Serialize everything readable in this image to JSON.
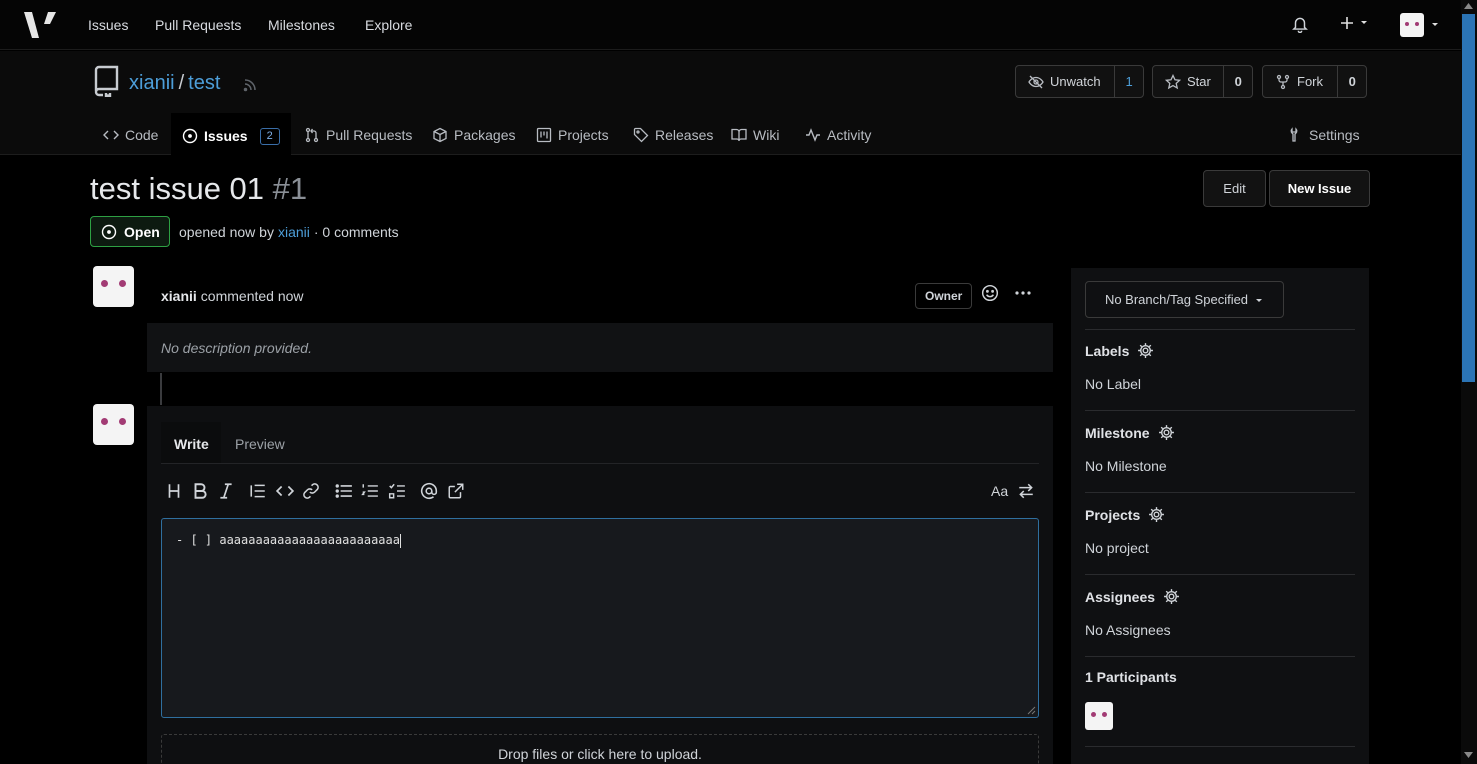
{
  "navbar": {
    "items": [
      "Issues",
      "Pull Requests",
      "Milestones",
      "Explore"
    ]
  },
  "repo": {
    "owner": "xianii",
    "separator": "/",
    "name": "test",
    "watch_label": "Unwatch",
    "watch_count": "1",
    "star_label": "Star",
    "star_count": "0",
    "fork_label": "Fork",
    "fork_count": "0",
    "tabs": [
      {
        "label": "Code",
        "icon": "code-icon"
      },
      {
        "label": "Issues",
        "icon": "issue-icon",
        "badge": "2",
        "active": true
      },
      {
        "label": "Pull Requests",
        "icon": "pull-request-icon"
      },
      {
        "label": "Packages",
        "icon": "package-icon"
      },
      {
        "label": "Projects",
        "icon": "project-icon"
      },
      {
        "label": "Releases",
        "icon": "tag-icon"
      },
      {
        "label": "Wiki",
        "icon": "book-icon"
      },
      {
        "label": "Activity",
        "icon": "pulse-icon"
      }
    ],
    "settings_label": "Settings"
  },
  "issue": {
    "title": "test issue 01",
    "number": "#1",
    "edit_label": "Edit",
    "new_issue_label": "New Issue",
    "state": "Open",
    "meta_prefix": "opened now by",
    "author": "xianii",
    "meta_suffix": "· 0 comments"
  },
  "comment": {
    "author": "xianii",
    "action": "commented now",
    "role": "Owner",
    "body": "No description provided."
  },
  "editor": {
    "write_tab": "Write",
    "preview_tab": "Preview",
    "font_toggle": "Aa",
    "content": "- [ ] aaaaaaaaaaaaaaaaaaaaaaaaa",
    "upload_text": "Drop files or click here to upload."
  },
  "sidebar": {
    "branch_label": "No Branch/Tag Specified",
    "labels_title": "Labels",
    "labels_value": "No Label",
    "milestone_title": "Milestone",
    "milestone_value": "No Milestone",
    "projects_title": "Projects",
    "projects_value": "No project",
    "assignees_title": "Assignees",
    "assignees_value": "No Assignees",
    "participants_title": "1 Participants"
  },
  "colors": {
    "accent": "#4d9ed9",
    "open_green": "#2ea043",
    "background": "#000000"
  }
}
